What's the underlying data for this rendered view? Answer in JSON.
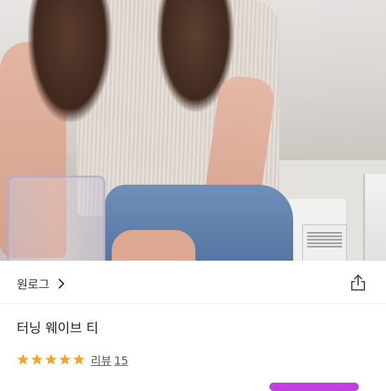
{
  "store": {
    "name": "원로그"
  },
  "product": {
    "title": "터닝 웨이브 티",
    "rating": 5,
    "rating_max": 5,
    "review_label": "리뷰",
    "review_count": "15"
  },
  "icons": {
    "chevron": "chevron-right-icon",
    "share": "share-icon",
    "star": "star-icon"
  },
  "colors": {
    "star": "#f5a623",
    "accent_pill": "#c23ee0"
  }
}
